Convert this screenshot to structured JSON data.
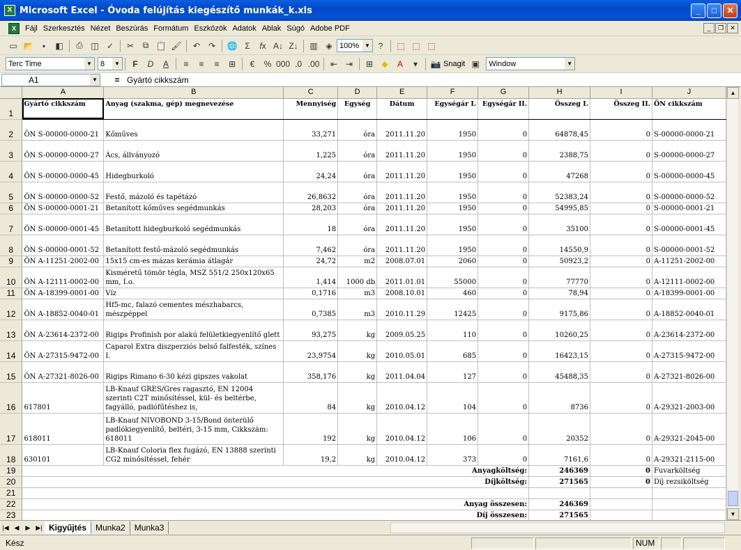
{
  "window": {
    "title": "Microsoft Excel - Óvoda felújítás kiegészítő munkák_k.xls"
  },
  "menu": [
    "Fájl",
    "Szerkesztés",
    "Nézet",
    "Beszúrás",
    "Formátum",
    "Eszközök",
    "Adatok",
    "Ablak",
    "Súgó",
    "Adobe PDF"
  ],
  "toolbar": {
    "zoom": "100%",
    "font": "Terc Time",
    "size": "8",
    "bold": "F",
    "italic": "D",
    "underline": "A",
    "snagit": "Snagit",
    "window": "Window"
  },
  "formula": {
    "cell": "A1",
    "eq": "=",
    "value": "Gyártó cikkszám"
  },
  "columns": [
    "A",
    "B",
    "C",
    "D",
    "E",
    "F",
    "G",
    "H",
    "I",
    "J"
  ],
  "header": [
    "Gyártó cikkszám",
    "Anyag (szakma, gép) megnevezése",
    "Mennyiség",
    "Egység",
    "Dátum",
    "Egységár I.",
    "Egységár II.",
    "Összeg I.",
    "Összeg II.",
    "ÖN cikkszám"
  ],
  "rows": [
    {
      "n": "2",
      "a": "ÖN S-00000-0000-21",
      "b": "Kőműves",
      "c": "33,271",
      "d": "óra",
      "e": "2011.11.20",
      "f": "1950",
      "g": "0",
      "h": "64878,45",
      "i": "0",
      "j": "S-00000-0000-21"
    },
    {
      "n": "3",
      "a": "ÖN S-00000-0000-27",
      "b": "Ács, állványozó",
      "c": "1,225",
      "d": "óra",
      "e": "2011.11.20",
      "f": "1950",
      "g": "0",
      "h": "2388,75",
      "i": "0",
      "j": "S-00000-0000-27"
    },
    {
      "n": "4",
      "a": "ÖN S-00000-0000-45",
      "b": "Hidegburkoló",
      "c": "24,24",
      "d": "óra",
      "e": "2011.11.20",
      "f": "1950",
      "g": "0",
      "h": "47268",
      "i": "0",
      "j": "S-00000-0000-45"
    },
    {
      "n": "5",
      "a": "ÖN S-00000-0000-52",
      "b": "Festő, mázoló és tapétázó",
      "c": "26,8632",
      "d": "óra",
      "e": "2011.11.20",
      "f": "1950",
      "g": "0",
      "h": "52383,24",
      "i": "0",
      "j": "S-00000-0000-52"
    },
    {
      "n": "6",
      "a": "ÖN S-00000-0001-21",
      "b": "Betanított kőműves segédmunkás",
      "c": "28,203",
      "d": "óra",
      "e": "2011.11.20",
      "f": "1950",
      "g": "0",
      "h": "54995,85",
      "i": "0",
      "j": "S-00000-0001-21"
    },
    {
      "n": "7",
      "a": "ÖN S-00000-0001-45",
      "b": "Betanított hidegburkoló segédmunkás",
      "c": "18",
      "d": "óra",
      "e": "2011.11.20",
      "f": "1950",
      "g": "0",
      "h": "35100",
      "i": "0",
      "j": "S-00000-0001-45"
    },
    {
      "n": "8",
      "a": "ÖN S-00000-0001-52",
      "b": "Betanított festő-mázoló segédmunkás",
      "c": "7,462",
      "d": "óra",
      "e": "2011.11.20",
      "f": "1950",
      "g": "0",
      "h": "14550,9",
      "i": "0",
      "j": "S-00000-0001-52"
    },
    {
      "n": "9",
      "a": "ÖN A-11251-2002-00",
      "b": "15x15 cm-es mázas kerámia átlagár",
      "c": "24,72",
      "d": "m2",
      "e": "2008.07.01",
      "f": "2060",
      "g": "0",
      "h": "50923,2",
      "i": "0",
      "j": "A-11251-2002-00"
    },
    {
      "n": "10",
      "a": "ÖN A-12111-0002-00",
      "b": "Kisméretű tömör tégla, MSZ 551/2 250x120x65 mm, I.o.",
      "c": "1,414",
      "d": "1000 db",
      "e": "2011.01.01",
      "f": "55000",
      "g": "0",
      "h": "77770",
      "i": "0",
      "j": "A-12111-0002-00"
    },
    {
      "n": "11",
      "a": "ÖN A-18399-0001-00",
      "b": "Víz",
      "c": "0,1716",
      "d": "m3",
      "e": "2008.10.01",
      "f": "460",
      "g": "0",
      "h": "78,94",
      "i": "0",
      "j": "A-18399-0001-00"
    },
    {
      "n": "12",
      "a": "ÖN A-18852-0040-01",
      "b": "Hf5-mc, falazó cementes mészhabarcs, mészpéppel",
      "c": "0,7385",
      "d": "m3",
      "e": "2010.11.29",
      "f": "12425",
      "g": "0",
      "h": "9175,86",
      "i": "0",
      "j": "A-18852-0040-01"
    },
    {
      "n": "13",
      "a": "ÖN A-23614-2372-00",
      "b": "Rigips Profinish por alakú felületkiegyenlítő glett",
      "c": "93,275",
      "d": "kg",
      "e": "2009.05.25",
      "f": "110",
      "g": "0",
      "h": "10260,25",
      "i": "0",
      "j": "A-23614-2372-00"
    },
    {
      "n": "14",
      "a": "ÖN A-27315-9472-00",
      "b": "Caparol Extra diszperziós belső falfesték, színes I.",
      "c": "23,9754",
      "d": "kg",
      "e": "2010.05.01",
      "f": "685",
      "g": "0",
      "h": "16423,15",
      "i": "0",
      "j": "A-27315-9472-00"
    },
    {
      "n": "15",
      "a": "ÖN A-27321-8026-00",
      "b": "Rigips Rimano 6-30 kézi gipszes vakolat",
      "c": "358,176",
      "d": "kg",
      "e": "2011.04.04",
      "f": "127",
      "g": "0",
      "h": "45488,35",
      "i": "0",
      "j": "A-27321-8026-00"
    },
    {
      "n": "16",
      "a": "617801",
      "b": "LB-Knauf GRES/Gres ragasztó, EN 12004 szerinti C2T minősítéssel, kül- és beltérbe, fagyálló, padlófűtéshez is,",
      "c": "84",
      "d": "kg",
      "e": "2010.04.12",
      "f": "104",
      "g": "0",
      "h": "8736",
      "i": "0",
      "j": "A-29321-2003-00"
    },
    {
      "n": "17",
      "a": "618011",
      "b": "LB-Knauf NIVOBOND 3-15/Bond önterülő padlókiegyenlítő, beltéri, 3-15 mm, Cikkszám: 618011",
      "c": "192",
      "d": "kg",
      "e": "2010.04.12",
      "f": "106",
      "g": "0",
      "h": "20352",
      "i": "0",
      "j": "A-29321-2045-00"
    },
    {
      "n": "18",
      "a": "630101",
      "b": "LB-Knauf Coloria flex fugázó, EN 13888 szerinti CG2 minősítéssel, fehér",
      "c": "19,2",
      "d": "kg",
      "e": "2010.04.12",
      "f": "373",
      "g": "0",
      "h": "7161,6",
      "i": "0",
      "j": "A-29321-2115-00"
    }
  ],
  "summary": [
    {
      "n": "19",
      "label": "Anyagköltség:",
      "h": "246369",
      "i": "0",
      "j": "Fuvarköltség"
    },
    {
      "n": "20",
      "label": "Díjköltség:",
      "h": "271565",
      "i": "0",
      "j": "Díj rezsiköltség"
    },
    {
      "n": "21",
      "label": "",
      "h": "",
      "i": "",
      "j": ""
    },
    {
      "n": "22",
      "label": "Anyag összesen:",
      "h": "246369",
      "i": "",
      "j": ""
    },
    {
      "n": "23",
      "label": "Díj összesen:",
      "h": "271565",
      "i": "",
      "j": ""
    }
  ],
  "tabs": [
    "Kigyűjtés",
    "Munka2",
    "Munka3"
  ],
  "status": {
    "ready": "Kész",
    "num": "NUM"
  }
}
